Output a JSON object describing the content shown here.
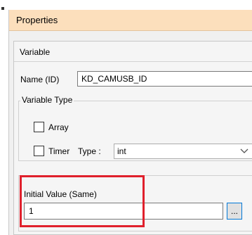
{
  "window": {
    "title": "Properties"
  },
  "panel": {
    "section_label": "Variable",
    "name_id": {
      "label": "Name (ID)",
      "value": "KD_CAMUSB_ID"
    },
    "variable_type": {
      "legend": "Variable Type",
      "array": {
        "label": "Array",
        "checked": false
      },
      "timer": {
        "label": "Timer",
        "checked": false
      },
      "type": {
        "label": "Type :",
        "value": "int",
        "chevron_icon": "chevron-down-icon"
      }
    },
    "initial_value": {
      "label": "Initial Value (Same)",
      "value": "1",
      "browse_label": "..."
    }
  },
  "annotation": {
    "highlight_color": "#e0202c"
  },
  "colors": {
    "titlebar": "#fcdfbc",
    "focus_border": "#0078d7"
  }
}
